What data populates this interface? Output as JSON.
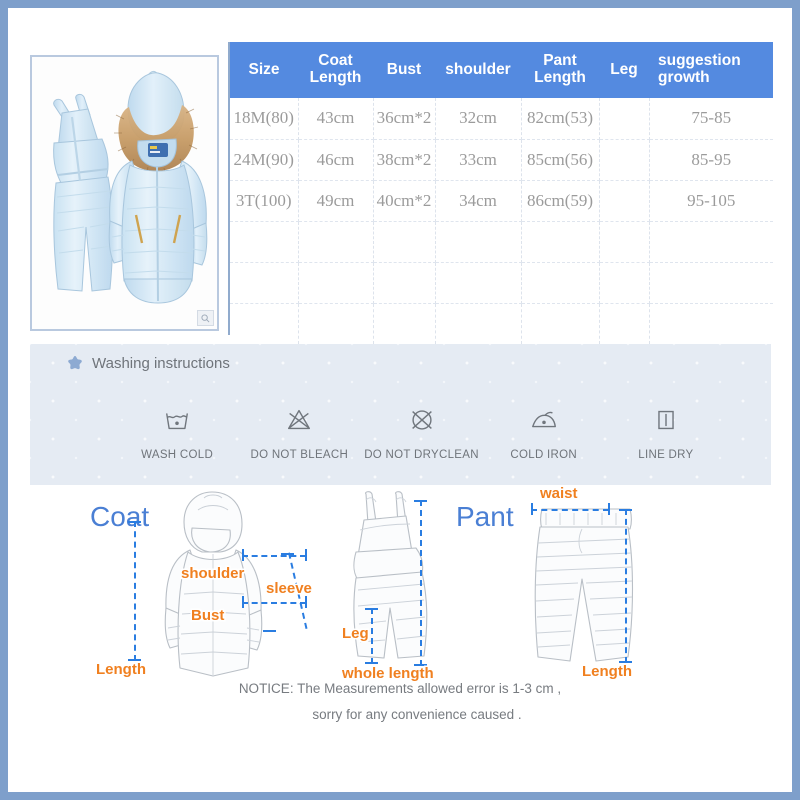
{
  "table": {
    "headers": [
      "Size",
      "Coat Length",
      "Bust",
      "shoulder",
      "Pant Length",
      "Leg",
      "suggestion growth"
    ],
    "header_lines": {
      "size": "Size",
      "coat_length_1": "Coat",
      "coat_length_2": "Length",
      "bust": "Bust",
      "shoulder": "shoulder",
      "pant_length_1": "Pant",
      "pant_length_2": "Length",
      "leg": "Leg",
      "growth_1": "suggestion",
      "growth_2": "growth"
    },
    "rows": [
      {
        "size": "18M(80)",
        "coat_length": "43cm",
        "bust": "36cm*2",
        "shoulder": "32cm",
        "pant_length": "82cm(53)",
        "leg": "",
        "growth": "75-85"
      },
      {
        "size": "24M(90)",
        "coat_length": "46cm",
        "bust": "38cm*2",
        "shoulder": "33cm",
        "pant_length": "85cm(56)",
        "leg": "",
        "growth": "85-95"
      },
      {
        "size": "3T(100)",
        "coat_length": "49cm",
        "bust": "40cm*2",
        "shoulder": "34cm",
        "pant_length": "86cm(59)",
        "leg": "",
        "growth": "95-105"
      },
      {
        "size": "",
        "coat_length": "",
        "bust": "",
        "shoulder": "",
        "pant_length": "",
        "leg": "",
        "growth": ""
      },
      {
        "size": "",
        "coat_length": "",
        "bust": "",
        "shoulder": "",
        "pant_length": "",
        "leg": "",
        "growth": ""
      },
      {
        "size": "",
        "coat_length": "",
        "bust": "",
        "shoulder": "",
        "pant_length": "",
        "leg": "",
        "growth": ""
      }
    ]
  },
  "photo": {
    "alt": "light blue baby down snowsuit set with fur hood and bib overalls",
    "zoom_badge_icon": "magnifier-icon"
  },
  "washing": {
    "star_icon": "star-icon",
    "title": "Washing instructions",
    "items": [
      {
        "icon": "wash-tub-icon",
        "label": "WASH COLD"
      },
      {
        "icon": "no-bleach-icon",
        "label": "DO NOT BLEACH"
      },
      {
        "icon": "no-dryclean-icon",
        "label": "DO NOT DRYCLEAN"
      },
      {
        "icon": "cold-iron-icon",
        "label": "COLD IRON"
      },
      {
        "icon": "line-dry-icon",
        "label": "LINE DRY"
      }
    ]
  },
  "diagrams": {
    "coat": {
      "title": "Coat",
      "labels": {
        "shoulder": "shoulder",
        "sleeve": "sleeve",
        "bust": "Bust",
        "length": "Length"
      }
    },
    "overall": {
      "labels": {
        "leg": "Leg",
        "whole_length": "whole length"
      }
    },
    "pant": {
      "title": "Pant",
      "labels": {
        "waist": "waist",
        "length": "Length"
      }
    }
  },
  "notice": {
    "line1": "NOTICE:   The Measurements allowed error is 1-3 cm ,",
    "line2": "sorry for any convenience caused ."
  },
  "colors": {
    "frame": "#7e9fcb",
    "header_blue": "#548ae0",
    "label_orange": "#f08020",
    "dash_blue": "#2a7de1",
    "wash_band": "#e5ebf3"
  }
}
